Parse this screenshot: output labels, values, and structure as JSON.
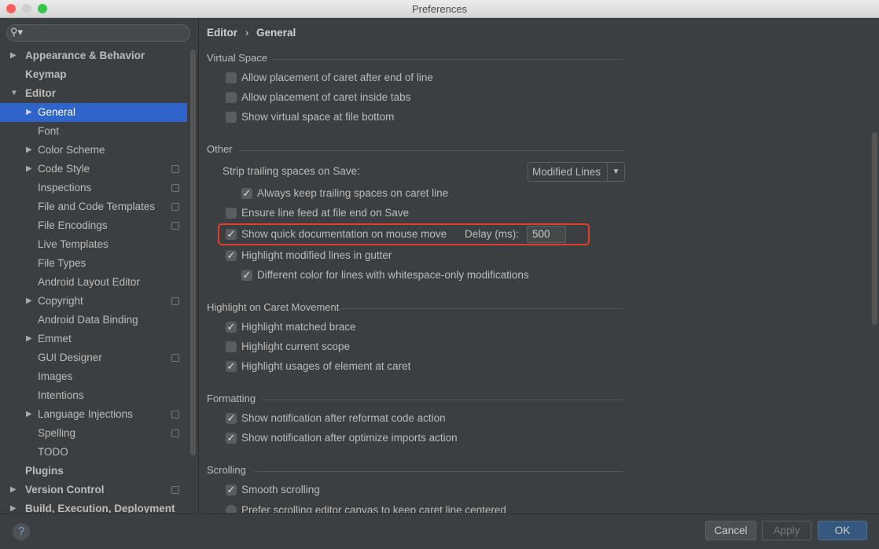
{
  "window": {
    "title": "Preferences"
  },
  "search": {
    "placeholder": "",
    "icon": "search-icon"
  },
  "sidebar": {
    "items": [
      {
        "label": "Appearance & Behavior",
        "level": 0,
        "arrow": "right",
        "bold": true
      },
      {
        "label": "Keymap",
        "level": 0,
        "arrow": "",
        "bold": true
      },
      {
        "label": "Editor",
        "level": 0,
        "arrow": "down",
        "bold": true
      },
      {
        "label": "General",
        "level": 1,
        "arrow": "right",
        "selected": true
      },
      {
        "label": "Font",
        "level": 1,
        "arrow": ""
      },
      {
        "label": "Color Scheme",
        "level": 1,
        "arrow": "right"
      },
      {
        "label": "Code Style",
        "level": 1,
        "arrow": "right",
        "project": true
      },
      {
        "label": "Inspections",
        "level": 1,
        "arrow": "",
        "project": true
      },
      {
        "label": "File and Code Templates",
        "level": 1,
        "arrow": "",
        "project": true
      },
      {
        "label": "File Encodings",
        "level": 1,
        "arrow": "",
        "project": true
      },
      {
        "label": "Live Templates",
        "level": 1,
        "arrow": ""
      },
      {
        "label": "File Types",
        "level": 1,
        "arrow": ""
      },
      {
        "label": "Android Layout Editor",
        "level": 1,
        "arrow": ""
      },
      {
        "label": "Copyright",
        "level": 1,
        "arrow": "right",
        "project": true
      },
      {
        "label": "Android Data Binding",
        "level": 1,
        "arrow": ""
      },
      {
        "label": "Emmet",
        "level": 1,
        "arrow": "right"
      },
      {
        "label": "GUI Designer",
        "level": 1,
        "arrow": "",
        "project": true
      },
      {
        "label": "Images",
        "level": 1,
        "arrow": ""
      },
      {
        "label": "Intentions",
        "level": 1,
        "arrow": ""
      },
      {
        "label": "Language Injections",
        "level": 1,
        "arrow": "right",
        "project": true
      },
      {
        "label": "Spelling",
        "level": 1,
        "arrow": "",
        "project": true
      },
      {
        "label": "TODO",
        "level": 1,
        "arrow": ""
      },
      {
        "label": "Plugins",
        "level": 0,
        "arrow": "",
        "bold": true
      },
      {
        "label": "Version Control",
        "level": 0,
        "arrow": "right",
        "bold": true,
        "project": true
      },
      {
        "label": "Build, Execution, Deployment",
        "level": 0,
        "arrow": "right",
        "bold": true
      }
    ]
  },
  "breadcrumb": {
    "parent": "Editor",
    "sep": "›",
    "current": "General"
  },
  "sections": {
    "virtual_space": "Virtual Space",
    "other": "Other",
    "caret": "Highlight on Caret Movement",
    "formatting": "Formatting",
    "scrolling": "Scrolling"
  },
  "options": {
    "caret_after_eol": {
      "label": "Allow placement of caret after end of line",
      "checked": false
    },
    "caret_inside_tabs": {
      "label": "Allow placement of caret inside tabs",
      "checked": false
    },
    "virtual_space_bottom": {
      "label": "Show virtual space at file bottom",
      "checked": false
    },
    "strip_label": "Strip trailing spaces on Save:",
    "strip_value": "Modified Lines",
    "keep_trailing": {
      "label": "Always keep trailing spaces on caret line",
      "checked": true
    },
    "line_feed": {
      "label": "Ensure line feed at file end on Save",
      "checked": false
    },
    "quick_doc": {
      "label": "Show quick documentation on mouse move",
      "checked": true
    },
    "delay_label": "Delay (ms):",
    "delay_value": "500",
    "highlight_modified": {
      "label": "Highlight modified lines in gutter",
      "checked": true
    },
    "diff_color": {
      "label": "Different color for lines with whitespace-only modifications",
      "checked": true
    },
    "matched_brace": {
      "label": "Highlight matched brace",
      "checked": true
    },
    "current_scope": {
      "label": "Highlight current scope",
      "checked": false
    },
    "usages": {
      "label": "Highlight usages of element at caret",
      "checked": true
    },
    "notif_reformat": {
      "label": "Show notification after reformat code action",
      "checked": true
    },
    "notif_imports": {
      "label": "Show notification after optimize imports action",
      "checked": true
    },
    "smooth": {
      "label": "Smooth scrolling",
      "checked": true
    },
    "prefer_scroll": {
      "label": "Prefer scrolling editor canvas to keep caret line centered",
      "checked": false
    }
  },
  "footer": {
    "help": "?",
    "cancel": "Cancel",
    "apply": "Apply",
    "ok": "OK"
  },
  "colors": {
    "selection": "#2f65ca",
    "highlight_box": "#e0402a",
    "ok_button": "#365880"
  }
}
